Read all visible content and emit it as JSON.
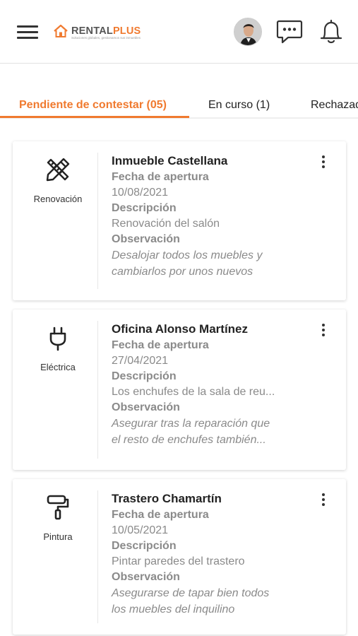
{
  "header": {
    "logo_main": "RENTAL",
    "logo_accent": "PLUS",
    "logo_tagline": "Soluciones globales, gestionamos sus inmuebles",
    "accent_color": "#f07a2f"
  },
  "tabs": [
    {
      "label": "Pendiente de contestar (05)",
      "active": true
    },
    {
      "label": "En curso (1)",
      "active": false
    },
    {
      "label": "Rechazad",
      "active": false
    }
  ],
  "cards": [
    {
      "category": "Renovación",
      "icon": "pencil-ruler-icon",
      "title": "Inmueble Castellana",
      "date_label": "Fecha de apertura",
      "date": "10/08/2021",
      "desc_label": "Descripción",
      "desc": "Renovación del salón",
      "obs_label": "Observación",
      "obs": "Desalojar todos los muebles y\ncambiarlos por unos nuevos"
    },
    {
      "category": "Eléctrica",
      "icon": "plug-icon",
      "title": "Oficina Alonso Martínez",
      "date_label": "Fecha de apertura",
      "date": "27/04/2021",
      "desc_label": "Descripción",
      "desc": "Los enchufes de la sala de reu...",
      "obs_label": "Observación",
      "obs": "Asegurar tras la reparación que\n el resto de enchufes también..."
    },
    {
      "category": "Pintura",
      "icon": "paint-roller-icon",
      "title": "Trastero Chamartín",
      "date_label": "Fecha de apertura",
      "date": "10/05/2021",
      "desc_label": "Descripción",
      "desc": "Pintar paredes del trastero",
      "obs_label": "Observación",
      "obs": "Asegurarse de tapar bien todos\nlos muebles del inquilino"
    }
  ]
}
